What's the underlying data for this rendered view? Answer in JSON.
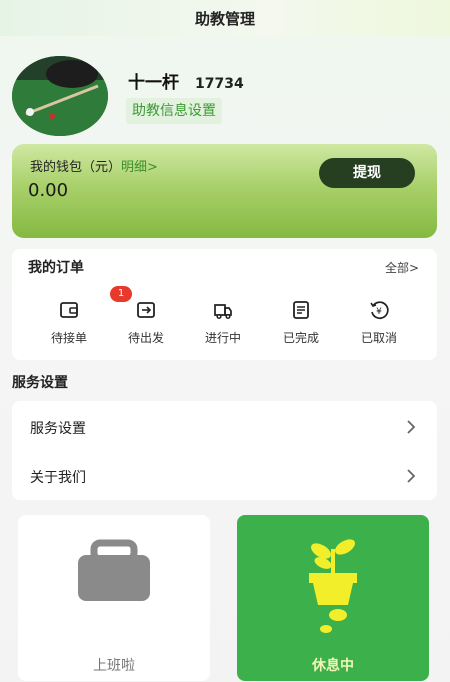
{
  "header": {
    "title": "助教管理"
  },
  "profile": {
    "name": "十一杆",
    "id": "17734",
    "info_button": "助教信息设置"
  },
  "wallet": {
    "label": "我的钱包（元）",
    "detail_link": "明细>",
    "amount": "0.00",
    "withdraw_button": "提现"
  },
  "orders": {
    "title": "我的订单",
    "all_link": "全部>",
    "badge_count": "1",
    "items": [
      {
        "label": "待接单",
        "icon": "wallet-icon"
      },
      {
        "label": "待出发",
        "icon": "depart-icon"
      },
      {
        "label": "进行中",
        "icon": "truck-icon"
      },
      {
        "label": "已完成",
        "icon": "document-icon"
      },
      {
        "label": "已取消",
        "icon": "refund-icon"
      }
    ]
  },
  "service_section": {
    "title": "服务设置",
    "rows": [
      {
        "label": "服务设置"
      },
      {
        "label": "关于我们"
      }
    ]
  },
  "status_cards": {
    "work_label": "上班啦",
    "rest_label": "休息中"
  },
  "colors": {
    "brand_green": "#3cb04a",
    "dark_green": "#263f21",
    "badge_red": "#e8392b"
  }
}
